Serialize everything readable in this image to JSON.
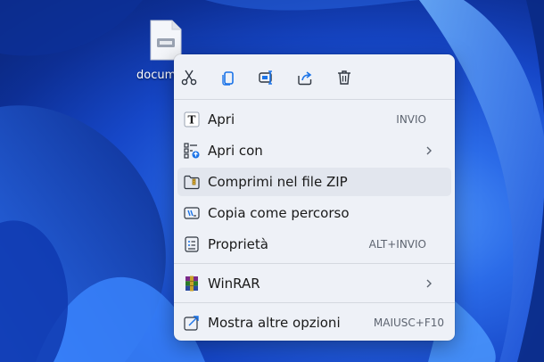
{
  "desktop": {
    "file_label": "docume"
  },
  "toolbar": {
    "buttons": [
      {
        "icon": "scissors-icon"
      },
      {
        "icon": "copy-icon"
      },
      {
        "icon": "rename-icon"
      },
      {
        "icon": "share-icon"
      },
      {
        "icon": "trash-icon"
      }
    ]
  },
  "menu": {
    "items": [
      {
        "label": "Apri",
        "shortcut": "INVIO",
        "icon": "text-file-icon"
      },
      {
        "label": "Apri con",
        "shortcut": "",
        "icon": "open-with-icon",
        "submenu": true
      },
      {
        "label": "Comprimi nel file ZIP",
        "shortcut": "",
        "icon": "zip-folder-icon"
      },
      {
        "label": "Copia come percorso",
        "shortcut": "",
        "icon": "copy-path-icon"
      },
      {
        "label": "Proprietà",
        "shortcut": "ALT+INVIO",
        "icon": "properties-icon"
      },
      {
        "label": "WinRAR",
        "shortcut": "",
        "icon": "winrar-icon",
        "submenu": true
      },
      {
        "label": "Mostra altre opzioni",
        "shortcut": "MAIUSC+F10",
        "icon": "more-options-icon"
      }
    ]
  },
  "colors": {
    "accent": "#1a73e8",
    "menu_bg": "#eef1f7",
    "hover_bg": "#e2e6ee"
  }
}
